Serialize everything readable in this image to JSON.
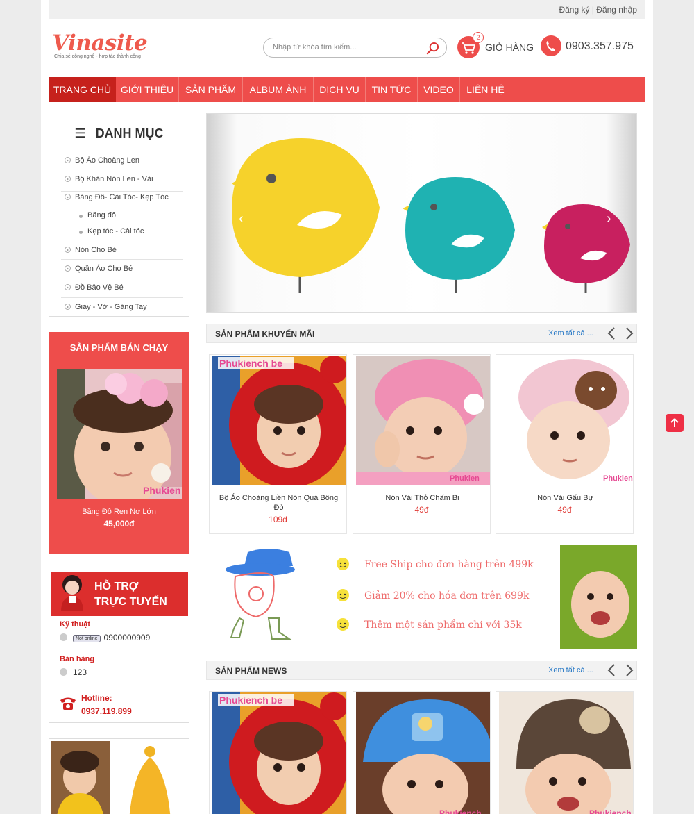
{
  "header": {
    "auth_links": "Đăng ký | Đăng nhập",
    "logo_name": "Vinasite",
    "logo_tagline": "Chia sẻ công nghệ - hợp tác thành công",
    "search_placeholder": "Nhập từ khóa tìm kiếm...",
    "cart_label": "GIỎ HÀNG",
    "cart_count": "2",
    "phone": "0903.357.975"
  },
  "nav": [
    "TRANG CHỦ",
    "GIỚI THIỆU",
    "SẢN PHẨM",
    "ALBUM ẢNH",
    "DỊCH VỤ",
    "TIN TỨC",
    "VIDEO",
    "LIÊN HỆ"
  ],
  "sidebar": {
    "danhmuc_title": "DANH MỤC",
    "categories": [
      "Bộ Áo Choàng Len",
      "Bộ Khăn Nón Len - Vải",
      "Băng Đô- Cài Tóc- Kẹp Tóc",
      "Nón Cho Bé",
      "Quần Áo Cho Bé",
      "Đồ Bảo Vệ Bé",
      "Giày - Vớ - Găng Tay"
    ],
    "subcategories": [
      "Băng đô",
      "Kẹp tóc - Cài tóc"
    ],
    "bestsell_title": "SẢN PHẨM BÁN CHẠY",
    "bestsell_name": "Băng Đô Ren Nơ Lớn",
    "bestsell_price": "45,000đ",
    "bestsell_watermark": "Phukien",
    "support_title_1": "HỖ TRỢ",
    "support_title_2": "TRỰC TUYẾN",
    "support_tech_label": "Kỹ thuật",
    "support_status": "Not online",
    "support_tech_phone": "0900000909",
    "support_sales_label": "Bán hàng",
    "support_sales_value": "123",
    "hotline_label": "Hotline:",
    "hotline_number": "0937.119.899"
  },
  "sections": {
    "promo_title": "SẢN PHẨM KHUYẾN MÃI",
    "news_title": "SẢN PHẨM NEWS",
    "see_all": "Xem tất cả ..."
  },
  "promo_products": [
    {
      "name": "Bộ Áo Choàng Liền Nón Quả Bông Đỏ",
      "price": "109đ",
      "watermark": "Phukiench be"
    },
    {
      "name": "Nón Vải Thỏ Chấm Bi",
      "price": "49đ",
      "watermark": "Phukien"
    },
    {
      "name": "Nón Vải Gấu Bự",
      "price": "49đ",
      "watermark": "Phukienc"
    }
  ],
  "news_products": [
    {
      "watermark": "Phukiench be"
    },
    {
      "watermark": "Phukiench"
    },
    {
      "watermark": "Phukiench"
    }
  ],
  "promo_banner": [
    "Free Ship cho đơn hàng trên 499k",
    "Giảm 20% cho hóa đơn trên 699k",
    "Thêm một sản phẩm chỉ với 35k"
  ],
  "colors": {
    "brand_red": "#ee4d4b",
    "nav_active": "#c6211c",
    "link_blue": "#2a7ac6",
    "price_red": "#e03b37"
  }
}
